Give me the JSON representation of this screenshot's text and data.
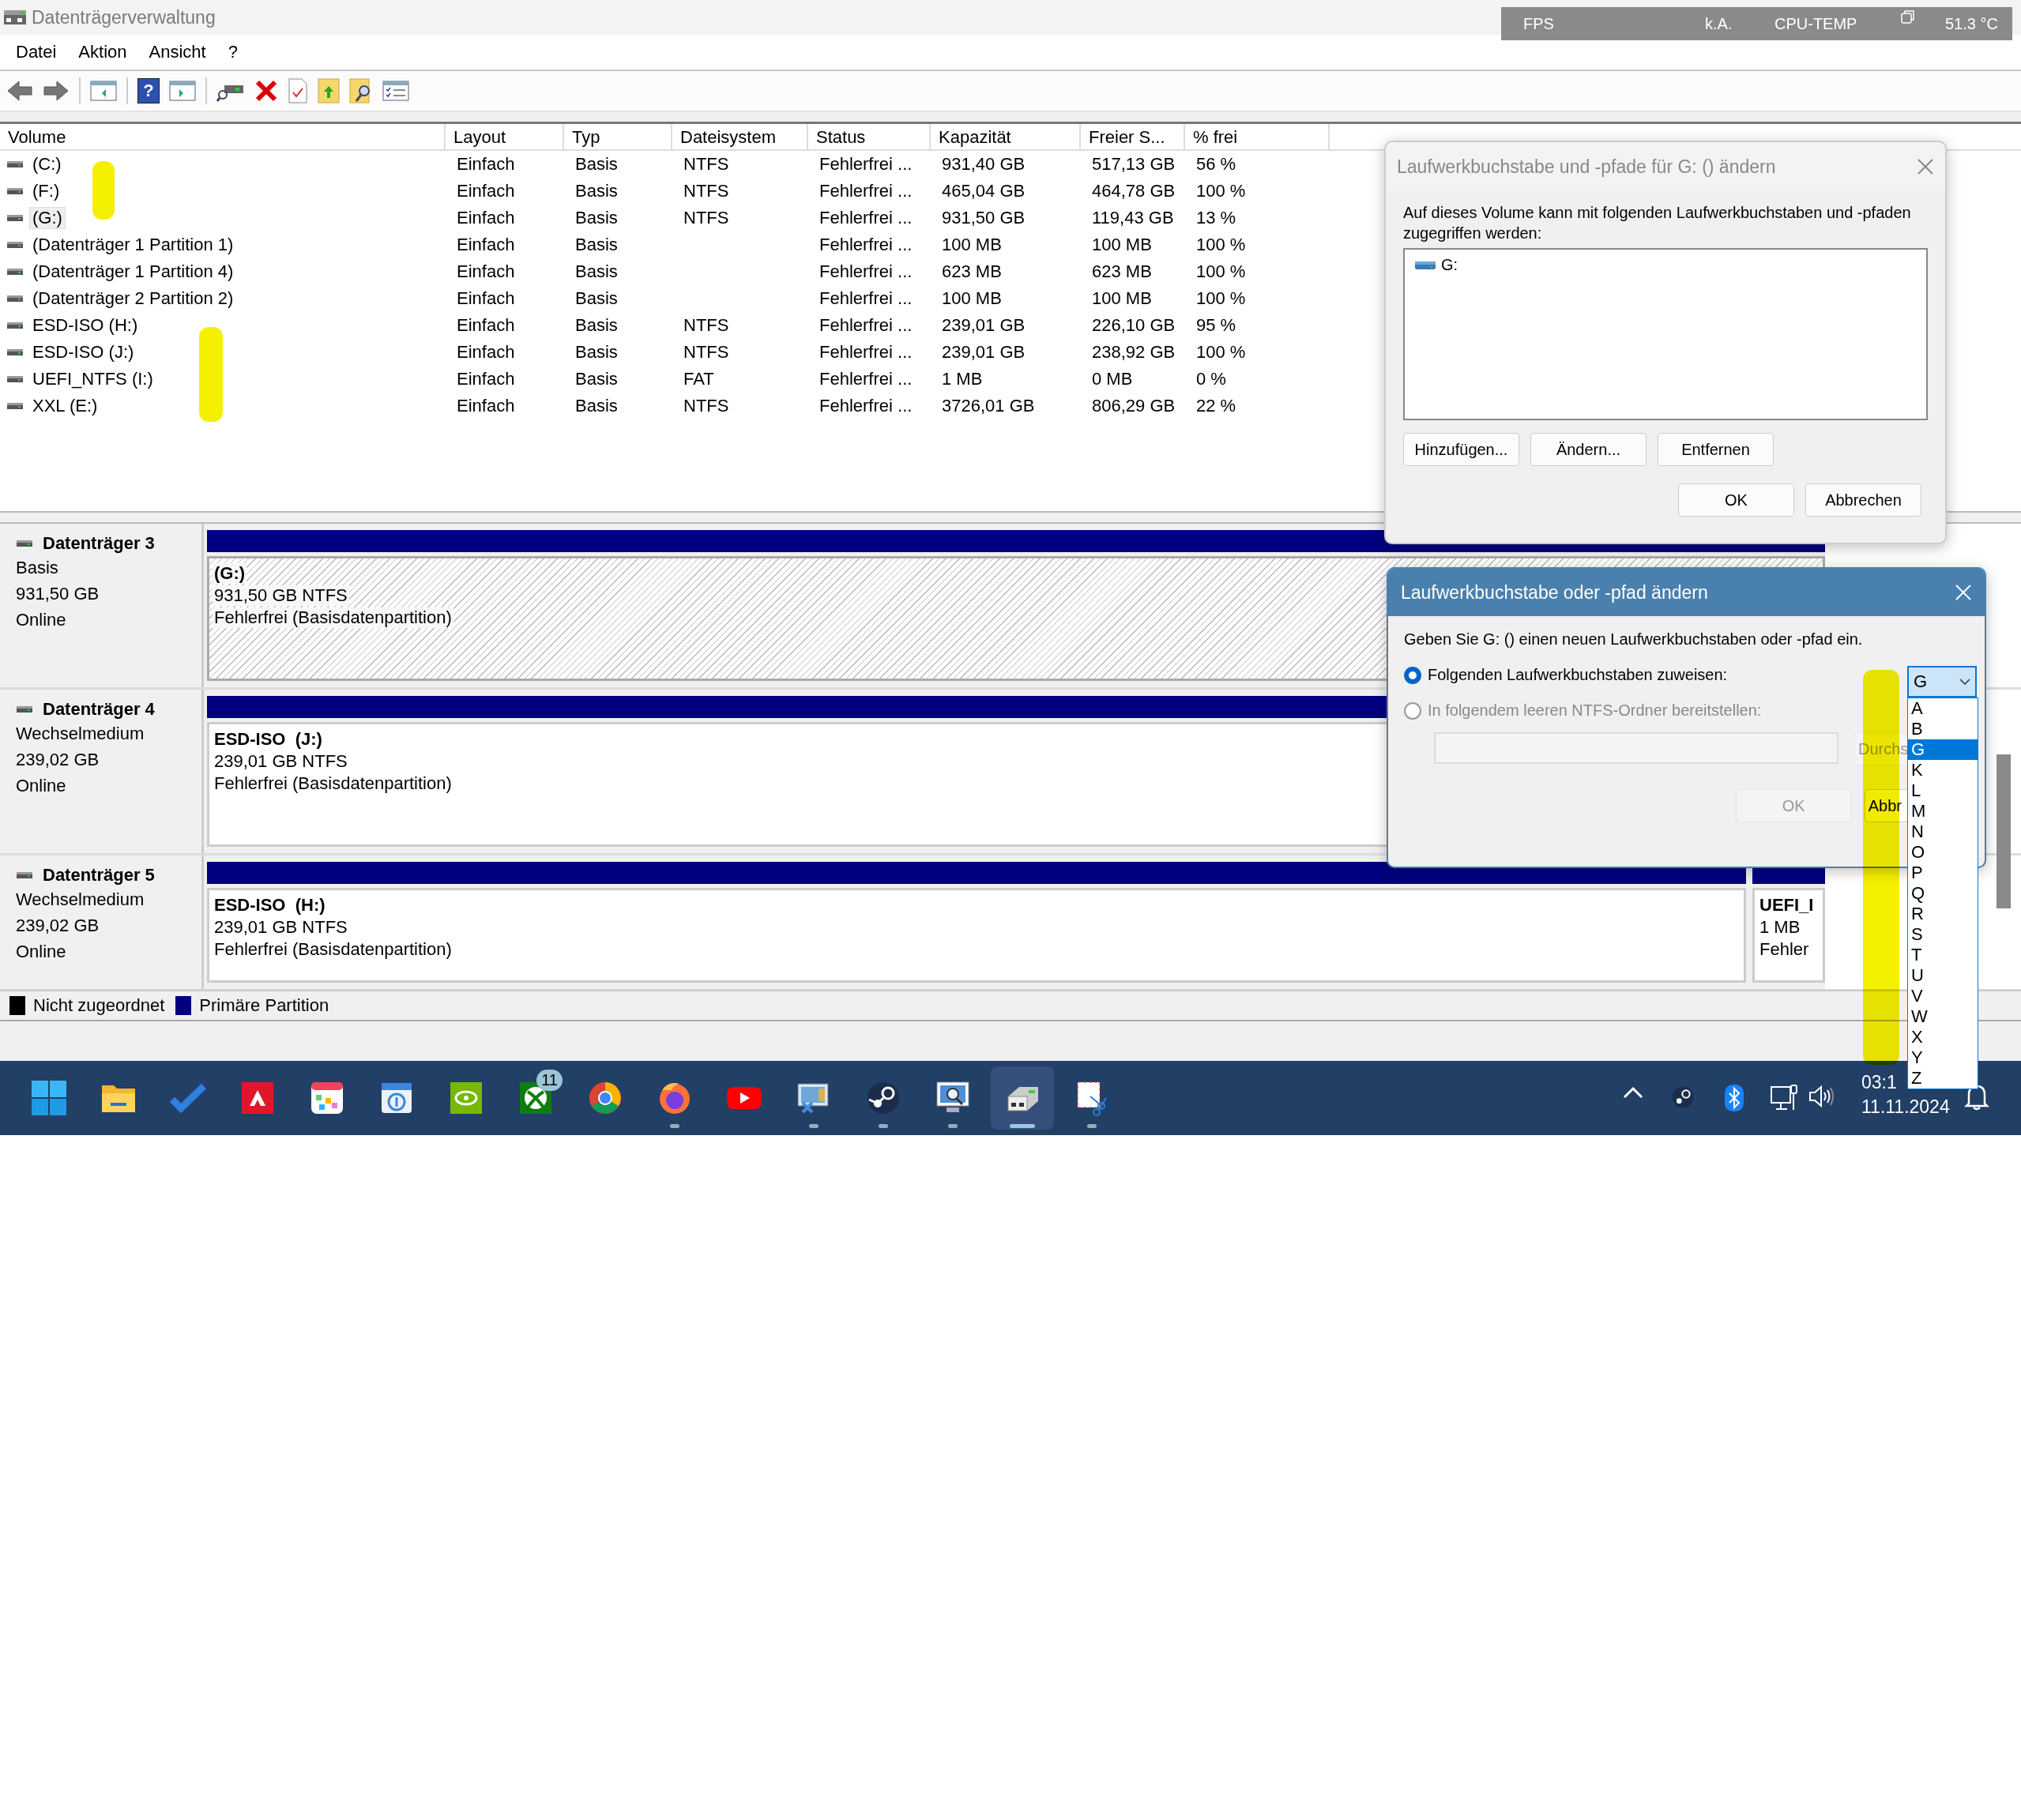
{
  "window": {
    "title": "Datenträgerverwaltung"
  },
  "overlay": {
    "fps_label": "FPS",
    "fps_value": "k.A.",
    "temp_label": "CPU-TEMP",
    "temp_value": "51.3 °C"
  },
  "menu": [
    "Datei",
    "Aktion",
    "Ansicht",
    "?"
  ],
  "toolbar": [
    {
      "kind": "back"
    },
    {
      "kind": "forward"
    },
    {
      "kind": "sep"
    },
    {
      "kind": "tree"
    },
    {
      "kind": "sep"
    },
    {
      "kind": "help",
      "label": "?"
    },
    {
      "kind": "pane"
    },
    {
      "kind": "sep"
    },
    {
      "kind": "connect"
    },
    {
      "kind": "delete"
    },
    {
      "kind": "properties"
    },
    {
      "kind": "folder-up"
    },
    {
      "kind": "folder-search"
    },
    {
      "kind": "checklist"
    }
  ],
  "volumes": {
    "columns": [
      "Volume",
      "Layout",
      "Typ",
      "Dateisystem",
      "Status",
      "Kapazität",
      "Freier S...",
      "% frei"
    ],
    "rows": [
      {
        "selected": false,
        "cells": [
          "(C:)",
          "Einfach",
          "Basis",
          "NTFS",
          "Fehlerfrei ...",
          "931,40 GB",
          "517,13 GB",
          "56 %"
        ]
      },
      {
        "selected": false,
        "cells": [
          "(F:)",
          "Einfach",
          "Basis",
          "NTFS",
          "Fehlerfrei ...",
          "465,04 GB",
          "464,78 GB",
          "100 %"
        ]
      },
      {
        "selected": true,
        "cells": [
          "(G:)",
          "Einfach",
          "Basis",
          "NTFS",
          "Fehlerfrei ...",
          "931,50 GB",
          "119,43 GB",
          "13 %"
        ]
      },
      {
        "selected": false,
        "cells": [
          "(Datenträger 1 Partition 1)",
          "Einfach",
          "Basis",
          "",
          "Fehlerfrei ...",
          "100 MB",
          "100 MB",
          "100 %"
        ]
      },
      {
        "selected": false,
        "cells": [
          "(Datenträger 1 Partition 4)",
          "Einfach",
          "Basis",
          "",
          "Fehlerfrei ...",
          "623 MB",
          "623 MB",
          "100 %"
        ]
      },
      {
        "selected": false,
        "cells": [
          "(Datenträger 2 Partition 2)",
          "Einfach",
          "Basis",
          "",
          "Fehlerfrei ...",
          "100 MB",
          "100 MB",
          "100 %"
        ]
      },
      {
        "selected": false,
        "cells": [
          "ESD-ISO (H:)",
          "Einfach",
          "Basis",
          "NTFS",
          "Fehlerfrei ...",
          "239,01 GB",
          "226,10 GB",
          "95 %"
        ]
      },
      {
        "selected": false,
        "cells": [
          "ESD-ISO (J:)",
          "Einfach",
          "Basis",
          "NTFS",
          "Fehlerfrei ...",
          "239,01 GB",
          "238,92 GB",
          "100 %"
        ]
      },
      {
        "selected": false,
        "cells": [
          "UEFI_NTFS (I:)",
          "Einfach",
          "Basis",
          "FAT",
          "Fehlerfrei ...",
          "1 MB",
          "0 MB",
          "0 %"
        ]
      },
      {
        "selected": false,
        "cells": [
          "XXL (E:)",
          "Einfach",
          "Basis",
          "NTFS",
          "Fehlerfrei ...",
          "3726,01 GB",
          "806,29 GB",
          "22 %"
        ]
      }
    ]
  },
  "disks": [
    {
      "name": "Datenträger 3",
      "type": "Basis",
      "size": "931,50 GB",
      "status": "Online",
      "partitions": [
        {
          "kind": "main",
          "title": "(G:)",
          "size": "931,50 GB NTFS",
          "status": "Fehlerfrei (Basisdatenpartition)",
          "selected": true
        }
      ]
    },
    {
      "name": "Datenträger 4",
      "type": "Wechselmedium",
      "size": "239,02 GB",
      "status": "Online",
      "partitions": [
        {
          "kind": "main",
          "title": "ESD-ISO  (J:)",
          "size": "239,01 GB NTFS",
          "status": "Fehlerfrei (Basisdatenpartition)",
          "selected": false
        }
      ]
    },
    {
      "name": "Datenträger 5",
      "type": "Wechselmedium",
      "size": "239,02 GB",
      "status": "Online",
      "partitions": [
        {
          "kind": "main",
          "title": "ESD-ISO  (H:)",
          "size": "239,01 GB NTFS",
          "status": "Fehlerfrei (Basisdatenpartition)",
          "selected": false
        },
        {
          "kind": "small",
          "title": "UEFI_I",
          "size": "1 MB",
          "status": "Fehler",
          "selected": false
        }
      ]
    }
  ],
  "legend": [
    {
      "label": "Nicht zugeordnet",
      "color": "#000000"
    },
    {
      "label": "Primäre Partition",
      "color": "#000080"
    }
  ],
  "dialog_paths": {
    "title": "Laufwerkbuchstabe und -pfade für G: () ändern",
    "description": "Auf dieses Volume kann mit folgenden Laufwerkbuchstaben und -pfaden zugegriffen werden:",
    "entries": [
      "G:"
    ],
    "buttons": [
      "Hinzufügen...",
      "Ändern...",
      "Entfernen"
    ],
    "ok": "OK",
    "cancel": "Abbrechen"
  },
  "dialog_change": {
    "title": "Laufwerkbuchstabe oder -pfad ändern",
    "prompt": "Geben Sie G: () einen neuen Laufwerkbuchstaben oder -pfad ein.",
    "options": [
      {
        "label": "Folgenden Laufwerkbuchstaben zuweisen:",
        "selected": true,
        "disabled": false
      },
      {
        "label": "In folgendem leeren NTFS-Ordner bereitstellen:",
        "selected": false,
        "disabled": true
      }
    ],
    "letter_value": "G",
    "path_field": {
      "disabled": true
    },
    "browse": "Durchs",
    "ok": {
      "label": "OK",
      "disabled": true
    },
    "cancel": "Abbr",
    "letters": [
      {
        "label": "A",
        "selected": false
      },
      {
        "label": "B",
        "selected": false
      },
      {
        "label": "G",
        "selected": true
      },
      {
        "label": "K",
        "selected": false
      },
      {
        "label": "L",
        "selected": false
      },
      {
        "label": "M",
        "selected": false
      },
      {
        "label": "N",
        "selected": false
      },
      {
        "label": "O",
        "selected": false
      },
      {
        "label": "P",
        "selected": false
      },
      {
        "label": "Q",
        "selected": false
      },
      {
        "label": "R",
        "selected": false
      },
      {
        "label": "S",
        "selected": false
      },
      {
        "label": "T",
        "selected": false
      },
      {
        "label": "U",
        "selected": false
      },
      {
        "label": "V",
        "selected": false
      },
      {
        "label": "W",
        "selected": false
      },
      {
        "label": "X",
        "selected": false
      },
      {
        "label": "Y",
        "selected": false
      },
      {
        "label": "Z",
        "selected": false
      }
    ]
  },
  "taskbar": {
    "apps": [
      {
        "kind": "start",
        "running": false,
        "selected": false
      },
      {
        "kind": "explorer",
        "running": false,
        "selected": false
      },
      {
        "kind": "todo",
        "running": false,
        "selected": false
      },
      {
        "kind": "amd",
        "running": false,
        "selected": false
      },
      {
        "kind": "calendar-grid",
        "running": false,
        "selected": false
      },
      {
        "kind": "calendar",
        "running": false,
        "selected": false
      },
      {
        "kind": "nvidia",
        "running": false,
        "selected": false
      },
      {
        "kind": "xbox",
        "running": false,
        "selected": false,
        "badge": "11"
      },
      {
        "kind": "chrome",
        "running": false,
        "selected": false
      },
      {
        "kind": "firefox",
        "running": true,
        "selected": false
      },
      {
        "kind": "youtube",
        "running": false,
        "selected": false
      },
      {
        "kind": "remote",
        "running": true,
        "selected": false
      },
      {
        "kind": "steam",
        "running": true,
        "selected": false
      },
      {
        "kind": "monitor",
        "running": true,
        "selected": false
      },
      {
        "kind": "diskmgmt",
        "running": true,
        "selected": true
      },
      {
        "kind": "snip",
        "running": true,
        "selected": false
      }
    ],
    "tray": [
      {
        "kind": "chevron"
      },
      {
        "kind": "steam"
      },
      {
        "kind": "bluetooth"
      },
      {
        "kind": "network"
      },
      {
        "kind": "volume"
      }
    ],
    "time": "03:1",
    "date": "11.11.2024"
  }
}
